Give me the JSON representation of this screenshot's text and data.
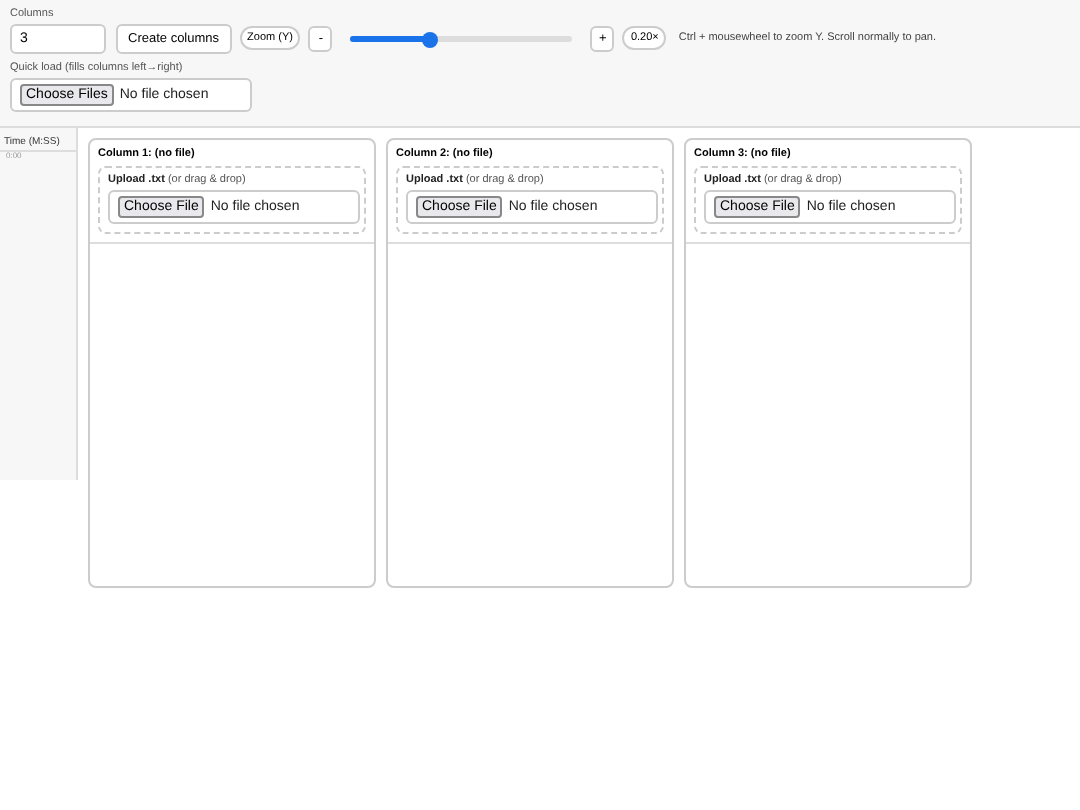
{
  "toolbar": {
    "columns_label": "Columns",
    "columns_value": "3",
    "create_button": "Create columns",
    "zoom_label": "Zoom (Y)",
    "zoom_out": "-",
    "zoom_slider": {
      "level": 0.36
    },
    "zoom_in": "+",
    "zoom_value": "0.20×",
    "hint": "Ctrl + mousewheel to zoom Y. Scroll normally to pan."
  },
  "quick_load": {
    "label": "Quick load (fills columns left→right)",
    "button": "Choose Files",
    "status": "No file chosen"
  },
  "time_axis": {
    "heading": "Time (M:SS)",
    "ticks": [
      "0:00"
    ]
  },
  "columns": [
    {
      "title": "Column 1: (no file)",
      "upload_label": "**Upload .txt** (or drag & drop)",
      "button": "Choose File",
      "status": "No file chosen"
    },
    {
      "title": "Column 2: (no file)",
      "upload_label": "**Upload .txt** (or drag & drop)",
      "button": "Choose File",
      "status": "No file chosen"
    },
    {
      "title": "Column 3: (no file)",
      "upload_label": "**Upload .txt** (or drag & drop)",
      "button": "Choose File",
      "status": "No file chosen"
    }
  ]
}
